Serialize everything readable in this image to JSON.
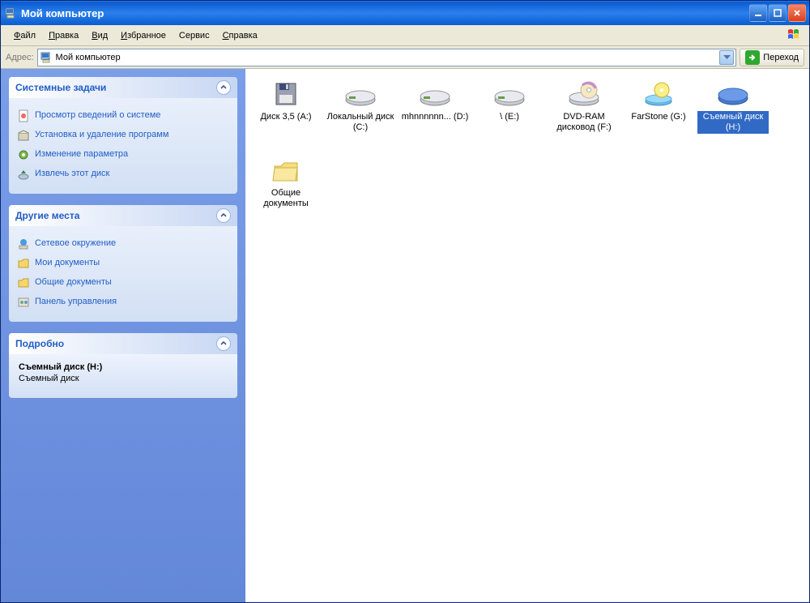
{
  "window": {
    "title": "Мой компьютер"
  },
  "menu": {
    "file": "Файл",
    "edit": "Правка",
    "view": "Вид",
    "favorites": "Избранное",
    "tools": "Сервис",
    "help": "Справка"
  },
  "addressbar": {
    "label": "Адрес:",
    "value": "Мой компьютер",
    "go": "Переход"
  },
  "sidebar": {
    "panel1": {
      "title": "Системные задачи",
      "items": [
        "Просмотр сведений о системе",
        "Установка и удаление программ",
        "Изменение параметра",
        "Извлечь этот диск"
      ]
    },
    "panel2": {
      "title": "Другие места",
      "items": [
        "Сетевое окружение",
        "Мои документы",
        "Общие документы",
        "Панель управления"
      ]
    },
    "panel3": {
      "title": "Подробно",
      "line1": "Съемный диск (H:)",
      "line2": "Съемный диск"
    }
  },
  "content": {
    "items": [
      {
        "label": "Диск 3,5 (A:)",
        "icon": "floppy"
      },
      {
        "label": "Локальный диск (C:)",
        "icon": "hdd"
      },
      {
        "label": "mhnnnnnn... (D:)",
        "icon": "hdd"
      },
      {
        "label": "\\ (E:)",
        "icon": "hdd"
      },
      {
        "label": "DVD-RAM дисковод (F:)",
        "icon": "dvd"
      },
      {
        "label": "FarStone (G:)",
        "icon": "cd"
      },
      {
        "label": "Съемный диск (H:)",
        "icon": "removable",
        "selected": true
      },
      {
        "label": "Общие документы",
        "icon": "folder"
      }
    ]
  }
}
